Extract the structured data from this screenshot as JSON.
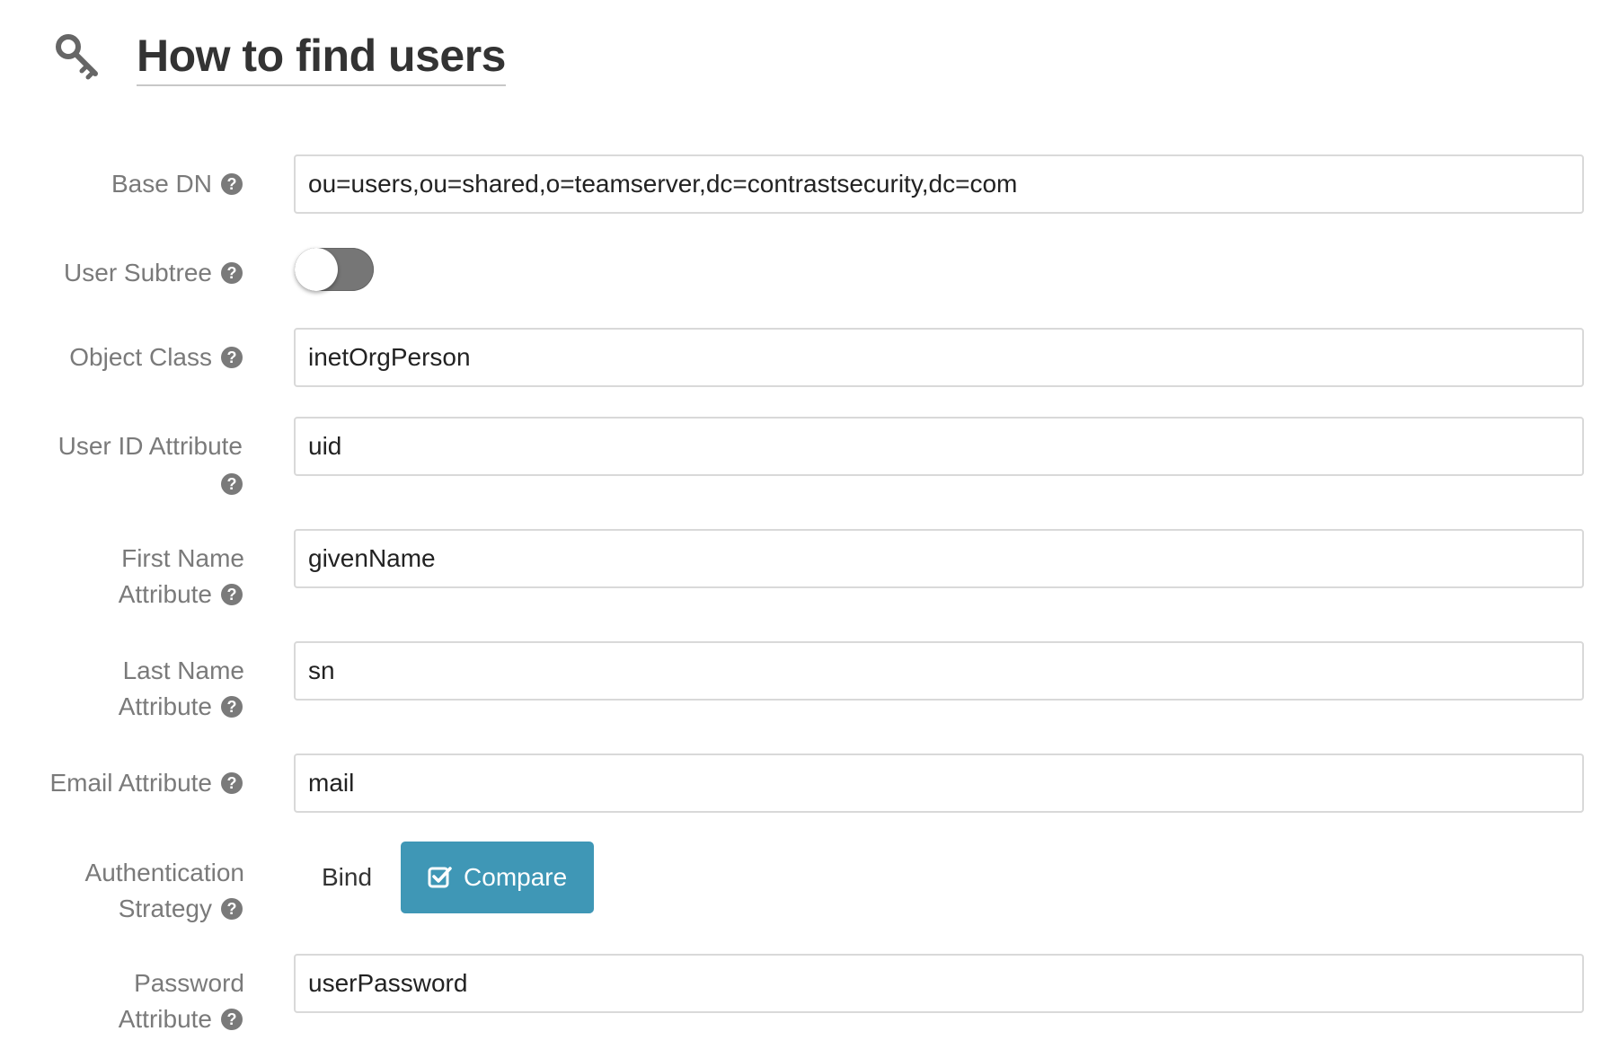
{
  "header": {
    "title": "How to find users",
    "icon": "key-icon"
  },
  "fields": {
    "base_dn": {
      "label": "Base DN",
      "value": "ou=users,ou=shared,o=teamserver,dc=contrastsecurity,dc=com"
    },
    "user_subtree": {
      "label": "User Subtree",
      "enabled": false
    },
    "object_class": {
      "label": "Object Class",
      "value": "inetOrgPerson"
    },
    "user_id_attribute": {
      "label": "User ID Attribute",
      "value": "uid"
    },
    "first_name_attribute": {
      "label_line1": "First Name",
      "label_line2": "Attribute",
      "value": "givenName"
    },
    "last_name_attribute": {
      "label_line1": "Last Name",
      "label_line2": "Attribute",
      "value": "sn"
    },
    "email_attribute": {
      "label": "Email Attribute",
      "value": "mail"
    },
    "authentication_strategy": {
      "label_line1": "Authentication",
      "label_line2": "Strategy",
      "options": [
        "Bind",
        "Compare"
      ],
      "selected": "Compare"
    },
    "password_attribute": {
      "label_line1": "Password",
      "label_line2": "Attribute",
      "value": "userPassword"
    }
  },
  "help_glyph": "?",
  "colors": {
    "accent": "#3f97b6",
    "label": "#7a7a7a",
    "toggle_off": "#767676"
  }
}
